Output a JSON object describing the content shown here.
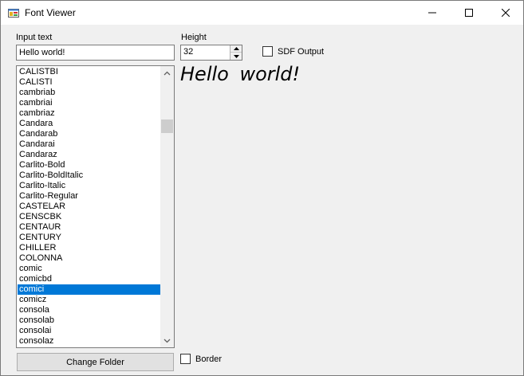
{
  "window": {
    "title": "Font Viewer"
  },
  "controls": {
    "input_label": "Input text",
    "input_value": "Hello world!",
    "height_label": "Height",
    "height_value": "32",
    "sdf_label": "SDF Output",
    "border_label": "Border",
    "change_folder_label": "Change Folder"
  },
  "font_list": {
    "items": [
      "CALISTBI",
      "CALISTI",
      "cambriab",
      "cambriai",
      "cambriaz",
      "Candara",
      "Candarab",
      "Candarai",
      "Candaraz",
      "Carlito-Bold",
      "Carlito-BoldItalic",
      "Carlito-Italic",
      "Carlito-Regular",
      "CASTELAR",
      "CENSCBK",
      "CENTAUR",
      "CENTURY",
      "CHILLER",
      "COLONNA",
      "comic",
      "comicbd",
      "comici",
      "comicz",
      "consola",
      "consolab",
      "consolai",
      "consolaz"
    ],
    "selected": "comici"
  },
  "preview": {
    "text": "Hello world!"
  },
  "colors": {
    "selection": "#0078d7",
    "background": "#f0f0f0"
  }
}
